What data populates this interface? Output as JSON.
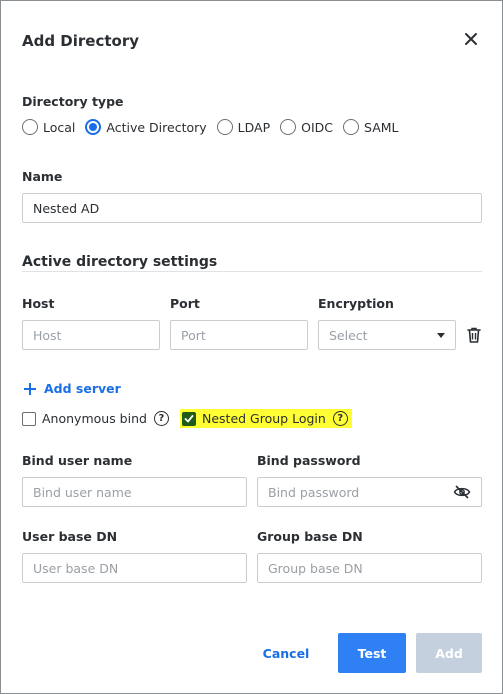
{
  "dialog": {
    "title": "Add Directory",
    "close_icon": "close-icon"
  },
  "directory_type": {
    "label": "Directory type",
    "options": [
      "Local",
      "Active Directory",
      "LDAP",
      "OIDC",
      "SAML"
    ],
    "selected": "Active Directory"
  },
  "name": {
    "label": "Name",
    "value": "Nested AD"
  },
  "ad_settings": {
    "title": "Active directory settings",
    "host_label": "Host",
    "host_placeholder": "Host",
    "port_label": "Port",
    "port_placeholder": "Port",
    "encryption_label": "Encryption",
    "encryption_value": "Select",
    "delete_icon": "trash-icon",
    "add_server": "Add server",
    "anonymous_bind": "Anonymous bind",
    "anonymous_bind_checked": false,
    "nested_group_login": "Nested Group Login",
    "nested_group_login_checked": true,
    "highlight_color": "#ffff33",
    "bind_user_label": "Bind user name",
    "bind_user_placeholder": "Bind user name",
    "bind_password_label": "Bind password",
    "bind_password_placeholder": "Bind password",
    "eye_icon": "eye-off-icon",
    "user_base_label": "User base DN",
    "user_base_placeholder": "User base DN",
    "group_base_label": "Group base DN",
    "group_base_placeholder": "Group base DN"
  },
  "footer": {
    "cancel": "Cancel",
    "test": "Test",
    "add": "Add"
  },
  "colors": {
    "accent": "#1a6fe6",
    "primary_button": "#2f7ff5",
    "disabled_button": "#c5d0de"
  }
}
